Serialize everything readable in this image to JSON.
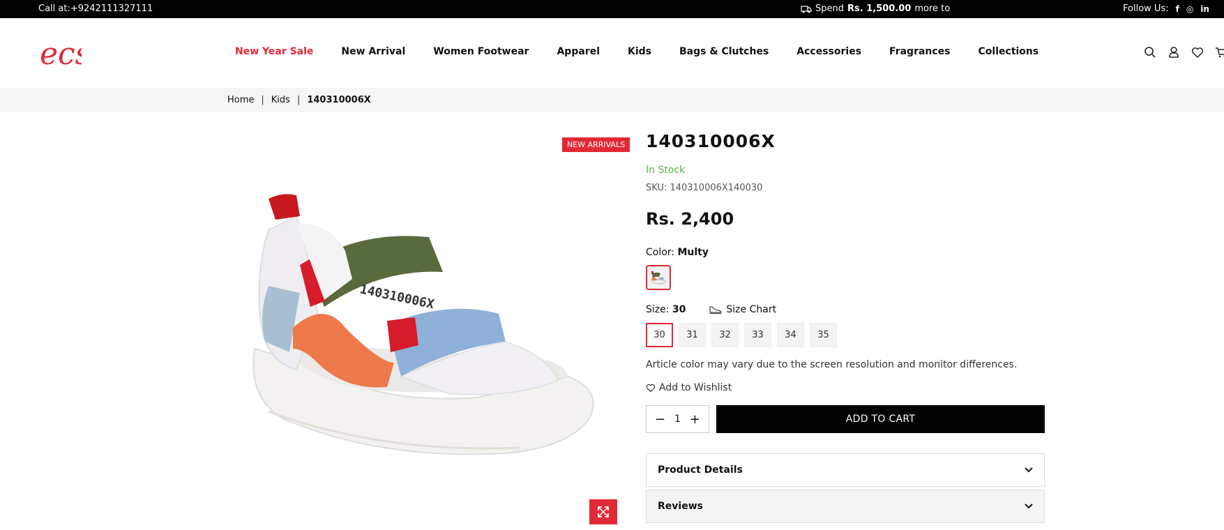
{
  "topbar": {
    "call": "Call at:+924211132711​1",
    "promo_prefix": "Spend",
    "promo_amount": "Rs. 1,500.00",
    "promo_suffix": "more to",
    "follow": "Follow Us:",
    "social": [
      "f",
      "◎",
      "in"
    ]
  },
  "header": {
    "logo_text": "ecs",
    "nav": [
      "New Year Sale",
      "New Arrival",
      "Women Footwear",
      "Apparel",
      "Kids",
      "Bags & Clutches",
      "Accessories",
      "Fragrances",
      "Collections"
    ]
  },
  "breadcrumb": {
    "items": [
      "Home",
      "Kids",
      "140310006X"
    ],
    "separator": "|"
  },
  "product": {
    "badge": "NEW ARRIVALS",
    "title": "140310006X",
    "stock": "In Stock",
    "sku": "SKU: 140310006X140030",
    "price": "Rs. 2,400",
    "color_label": "Color:",
    "color_value": "Multy",
    "size_label": "Size:",
    "size_value": "30",
    "size_chart": "Size Chart",
    "sizes": [
      "30",
      "31",
      "32",
      "33",
      "34",
      "35"
    ],
    "selected_size": "30",
    "note": "Article color may vary due to the screen resolution and monitor differences.",
    "wishlist": "Add to Wishlist",
    "quantity": "1",
    "minus": "−",
    "plus": "+",
    "add_to_cart": "ADD TO CART",
    "accordions": [
      "Product Details",
      "Reviews"
    ],
    "image_print": "140310006X"
  },
  "colors": {
    "brand_red": "#e02a36",
    "in_stock_green": "#5ab34a",
    "topbar_bg": "#000000"
  }
}
